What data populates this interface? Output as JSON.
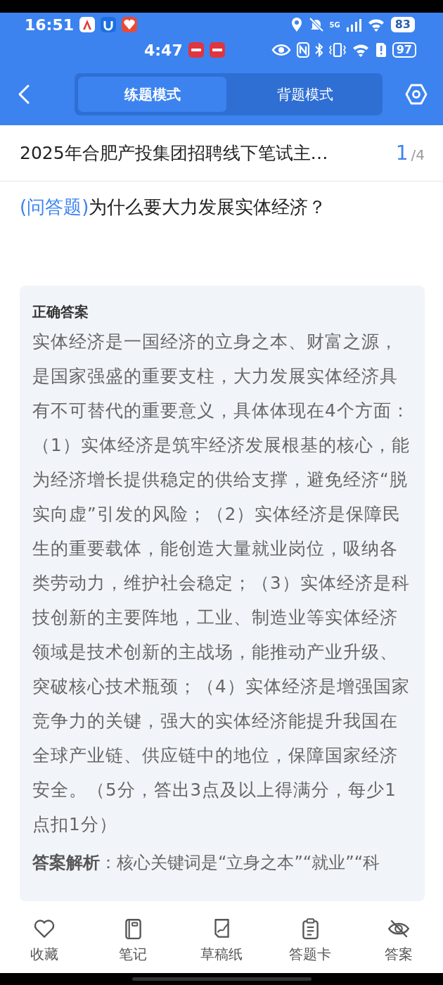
{
  "status_bar": {
    "time": "16:51",
    "network": "5G",
    "battery": "83"
  },
  "status_bar_2": {
    "time": "4:47",
    "battery": "97"
  },
  "tabs": [
    {
      "label": "练题模式",
      "selected": true
    },
    {
      "label": "背题模式",
      "selected": false
    }
  ],
  "title": "2025年合肥产投集团招聘线下笔试主…",
  "counter": {
    "current": "1",
    "total": "/4"
  },
  "question": {
    "type": "(问答题)",
    "text": "为什么要大力发展实体经济？"
  },
  "answer": {
    "heading": "正确答案",
    "paragraphs": [
      "实体经济是一国经济的立身之本、财富之源，是国家强盛的重要支柱，大力发展实体经济具有不可替代的重要意义，具体体现在4个方面：",
      "（1）实体经济是筑牢经济发展根基的核心，能为经济增长提供稳定的供给支撑，避免经济“脱实向虚”引发的风险；（2）实体经济是保障民生的重要载体，能创造大量就业岗位，吸纳各类劳动力，维护社会稳定；（3）实体经济是科技创新的主要阵地，工业、制造业等实体经济领域是技术创新的主战场，能推动产业升级、突破核心技术瓶颈；（4）实体经济是增强国家竞争力的关键，强大的实体经济能提升我国在全球产业链、供应链中的地位，保障国家经济安全。（5分，答出3点及以上得满分，每少1点扣1分）"
    ]
  },
  "analysis": "**答案解析**：核心关键词是“立身之本”“就业”“科",
  "bottom_nav": [
    {
      "label": "收藏"
    },
    {
      "label": "笔记"
    },
    {
      "label": "草稿纸"
    },
    {
      "label": "答题卡"
    },
    {
      "label": "答案"
    }
  ]
}
